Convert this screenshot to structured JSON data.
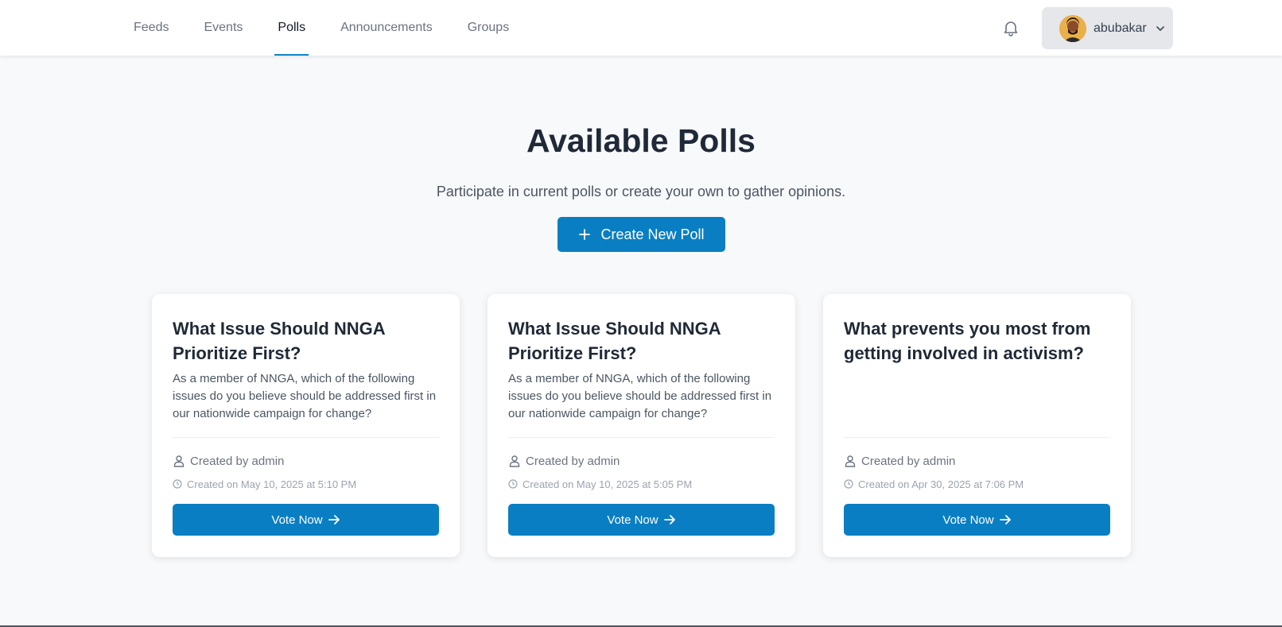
{
  "nav": {
    "items": [
      {
        "label": "Feeds",
        "name": "nav-feeds",
        "active": false
      },
      {
        "label": "Events",
        "name": "nav-events",
        "active": false
      },
      {
        "label": "Polls",
        "name": "nav-polls",
        "active": true
      },
      {
        "label": "Announcements",
        "name": "nav-announcements",
        "active": false
      },
      {
        "label": "Groups",
        "name": "nav-groups",
        "active": false
      }
    ]
  },
  "user": {
    "name": "abubakar"
  },
  "icons": {
    "notifications": "bell-icon",
    "user_menu": "chevron-down-icon",
    "create": "plus-icon",
    "creator": "user-icon",
    "date": "clock-icon",
    "vote": "arrow-right-icon"
  },
  "colors": {
    "primary": "#0a7ec2",
    "active_underline": "#0f84c9",
    "background": "#f8f9fb",
    "card": "#ffffff"
  },
  "hero": {
    "title": "Available Polls",
    "subtitle": "Participate in current polls or create your own to gather opinions.",
    "create_label": "Create New Poll"
  },
  "polls": [
    {
      "title": "What Issue Should NNGA Prioritize First?",
      "description": "As a member of NNGA, which of the following issues do you believe should be addressed first in our nationwide campaign for change?",
      "creator": "Created by admin",
      "created_on": "Created on May 10, 2025 at 5:10 PM",
      "vote_label": "Vote Now"
    },
    {
      "title": "What Issue Should NNGA Prioritize First?",
      "description": "As a member of NNGA, which of the following issues do you believe should be addressed first in our nationwide campaign for change?",
      "creator": "Created by admin",
      "created_on": "Created on May 10, 2025 at 5:05 PM",
      "vote_label": "Vote Now"
    },
    {
      "title": "What prevents you most from getting involved in activism?",
      "description": "",
      "creator": "Created by admin",
      "created_on": "Created on Apr 30, 2025 at 7:06 PM",
      "vote_label": "Vote Now"
    }
  ]
}
